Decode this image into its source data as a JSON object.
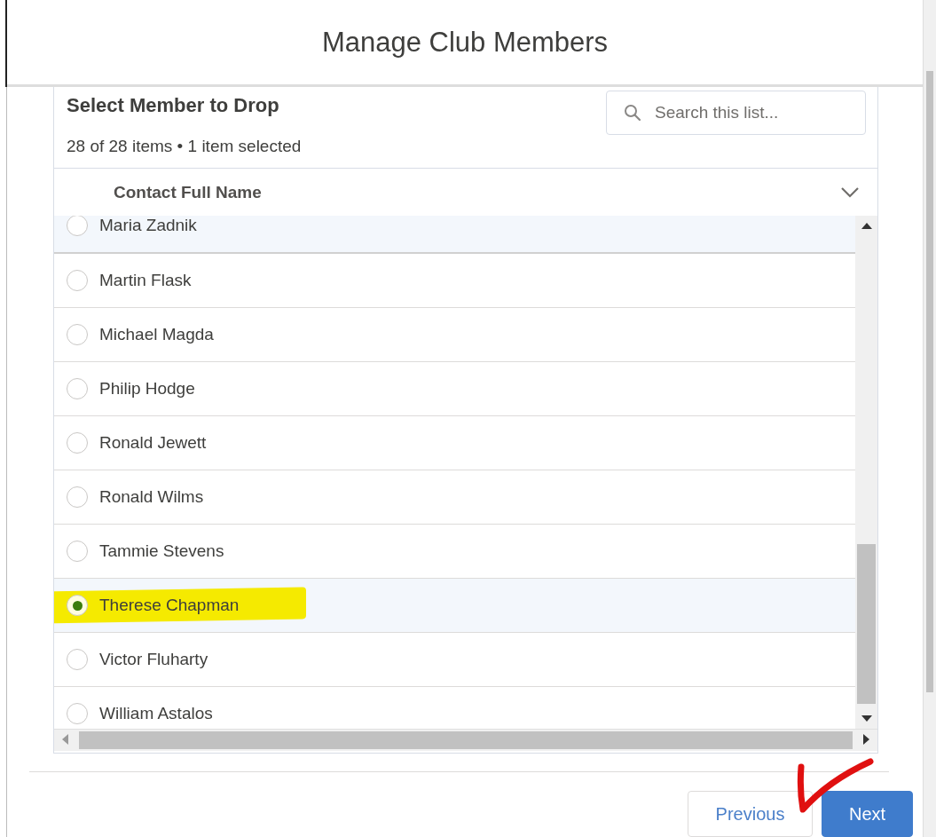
{
  "modal": {
    "title": "Manage Club Members"
  },
  "list": {
    "title": "Select Member to Drop",
    "summary": "28 of 28 items • 1 item selected",
    "search": {
      "placeholder": "Search this list..."
    },
    "column": "Contact Full Name",
    "rows": [
      {
        "name": "Maria Zadnik",
        "selected": false,
        "hover": true,
        "marked": false
      },
      {
        "name": "Martin Flask",
        "selected": false,
        "hover": false,
        "marked": false
      },
      {
        "name": "Michael Magda",
        "selected": false,
        "hover": false,
        "marked": false
      },
      {
        "name": "Philip Hodge",
        "selected": false,
        "hover": false,
        "marked": false
      },
      {
        "name": "Ronald Jewett",
        "selected": false,
        "hover": false,
        "marked": false
      },
      {
        "name": "Ronald Wilms",
        "selected": false,
        "hover": false,
        "marked": false
      },
      {
        "name": "Tammie Stevens",
        "selected": false,
        "hover": false,
        "marked": false
      },
      {
        "name": "Therese Chapman",
        "selected": true,
        "hover": false,
        "marked": true
      },
      {
        "name": "Victor Fluharty",
        "selected": false,
        "hover": false,
        "marked": false
      },
      {
        "name": "William Astalos",
        "selected": false,
        "hover": false,
        "marked": false
      }
    ]
  },
  "footer": {
    "buttons": [
      {
        "label": "Previous",
        "kind": "neutral"
      },
      {
        "label": "Next",
        "kind": "brand"
      }
    ]
  }
}
